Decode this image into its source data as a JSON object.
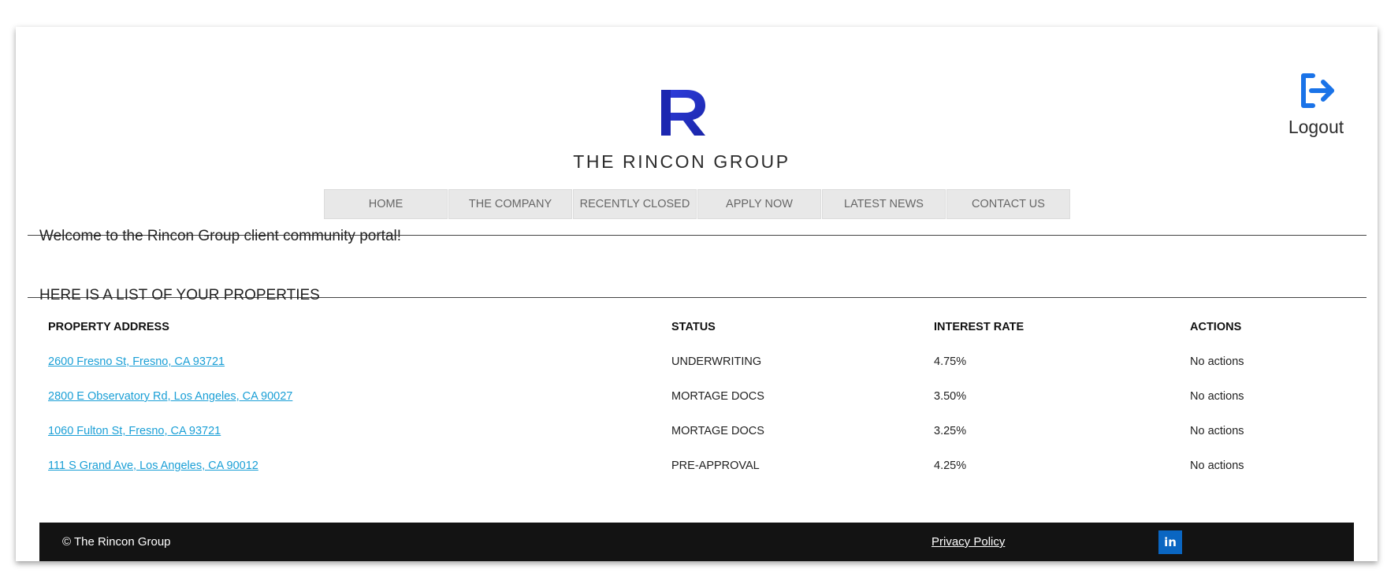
{
  "brand": {
    "name": "THE RINCON GROUP",
    "colors": {
      "logo_blue": "#2233cc",
      "accent_blue": "#1a73e8",
      "link_blue": "#1a9fd6"
    }
  },
  "header": {
    "logout_label": "Logout",
    "logout_icon": "logout-icon"
  },
  "nav": {
    "items": [
      "HOME",
      "THE COMPANY",
      "RECENTLY CLOSED",
      "APPLY NOW",
      "LATEST NEWS",
      "CONTACT US"
    ]
  },
  "welcome_text": "Welcome to the Rincon Group client community portal!",
  "properties": {
    "title": "HERE IS A LIST OF YOUR PROPERTIES",
    "columns": [
      "PROPERTY ADDRESS",
      "STATUS",
      "INTEREST RATE",
      "ACTIONS"
    ],
    "rows": [
      {
        "address": "2600 Fresno St, Fresno, CA 93721",
        "status": "UNDERWRITING",
        "rate": "4.75%",
        "actions": "No actions"
      },
      {
        "address": "2800 E Observatory Rd, Los Angeles, CA 90027",
        "status": "MORTAGE DOCS",
        "rate": "3.50%",
        "actions": "No actions"
      },
      {
        "address": "1060 Fulton St, Fresno, CA 93721",
        "status": "MORTAGE DOCS",
        "rate": "3.25%",
        "actions": "No actions"
      },
      {
        "address": "111 S Grand Ave, Los Angeles, CA 90012",
        "status": "PRE-APPROVAL",
        "rate": "4.25%",
        "actions": "No actions"
      }
    ]
  },
  "footer": {
    "copyright": "© The Rincon Group",
    "privacy_label": "Privacy Policy",
    "linkedin_label": "in",
    "linkedin_icon": "linkedin-icon"
  }
}
